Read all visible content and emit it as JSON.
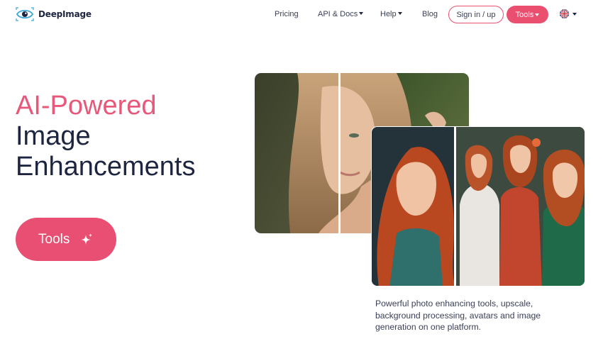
{
  "brand": {
    "name": "DeepImage",
    "logo_icon": "eye-logo-icon"
  },
  "nav": {
    "pricing": "Pricing",
    "api_docs": "API & Docs",
    "help": "Help",
    "blog": "Blog",
    "signin": "Sign in / up",
    "tools": "Tools",
    "language_icon": "uk-flag-icon"
  },
  "hero": {
    "title_accent": "AI-Powered",
    "title_line2": "Image",
    "title_line3": "Enhancements",
    "cta_label": "Tools",
    "cta_icon": "sparkle-icon"
  },
  "description": "Powerful photo enhancing tools, upscale, background processing, avatars and image generation on one platform.",
  "colors": {
    "accent": "#e8587a",
    "button": "#ea4f70",
    "text_dark": "#1e2540"
  }
}
